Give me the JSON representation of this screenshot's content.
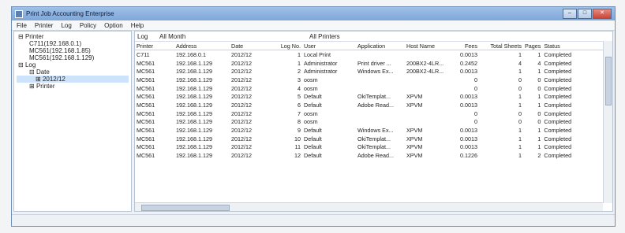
{
  "window": {
    "title": "Print Job Accounting Enterprise"
  },
  "menu": [
    "File",
    "Printer",
    "Log",
    "Policy",
    "Option",
    "Help"
  ],
  "tree": {
    "printer_root": "Printer",
    "printers": [
      "C711(192.168.0.1)",
      "MC561(192.168.1.85)",
      "MC561(192.168.1.129)"
    ],
    "log_root": "Log",
    "date": "Date",
    "date_child": "2012/12",
    "printer_child": "Printer"
  },
  "filter": {
    "label": "Log",
    "month": "All Month",
    "printers": "All Printers"
  },
  "table": {
    "columns": [
      "Printer",
      "Address",
      "Date",
      "Log No.",
      "User",
      "Application",
      "Host Name",
      "Fees",
      "Total Sheets",
      "Pages",
      "Status"
    ],
    "rows": [
      [
        "C711",
        "192.168.0.1",
        "2012/12",
        "1",
        "Local Print",
        "",
        "",
        "0.0013",
        "1",
        "1",
        "Completed"
      ],
      [
        "MC561",
        "192.168.1.129",
        "2012/12",
        "1",
        "Administrator",
        "Print driver ...",
        "200BX2-4LR...",
        "0.2452",
        "4",
        "4",
        "Completed"
      ],
      [
        "MC561",
        "192.168.1.129",
        "2012/12",
        "2",
        "Administrator",
        "Windows Ex...",
        "200BX2-4LR...",
        "0.0013",
        "1",
        "1",
        "Completed"
      ],
      [
        "MC561",
        "192.168.1.129",
        "2012/12",
        "3",
        "oosm",
        "",
        "",
        "0",
        "0",
        "0",
        "Completed"
      ],
      [
        "MC561",
        "192.168.1.129",
        "2012/12",
        "4",
        "oosm",
        "",
        "",
        "0",
        "0",
        "0",
        "Completed"
      ],
      [
        "MC561",
        "192.168.1.129",
        "2012/12",
        "5",
        "Default",
        "OkiTemplat...",
        "XPVM",
        "0.0013",
        "1",
        "1",
        "Completed"
      ],
      [
        "MC561",
        "192.168.1.129",
        "2012/12",
        "6",
        "Default",
        "Adobe Read...",
        "XPVM",
        "0.0013",
        "1",
        "1",
        "Completed"
      ],
      [
        "MC561",
        "192.168.1.129",
        "2012/12",
        "7",
        "oosm",
        "",
        "",
        "0",
        "0",
        "0",
        "Completed"
      ],
      [
        "MC561",
        "192.168.1.129",
        "2012/12",
        "8",
        "oosm",
        "",
        "",
        "0",
        "0",
        "0",
        "Completed"
      ],
      [
        "MC561",
        "192.168.1.129",
        "2012/12",
        "9",
        "Default",
        "Windows Ex...",
        "XPVM",
        "0.0013",
        "1",
        "1",
        "Completed"
      ],
      [
        "MC561",
        "192.168.1.129",
        "2012/12",
        "10",
        "Default",
        "OkiTemplat...",
        "XPVM",
        "0.0013",
        "1",
        "1",
        "Completed"
      ],
      [
        "MC561",
        "192.168.1.129",
        "2012/12",
        "11",
        "Default",
        "OkiTemplat...",
        "XPVM",
        "0.0013",
        "1",
        "1",
        "Completed"
      ],
      [
        "MC561",
        "192.168.1.129",
        "2012/12",
        "12",
        "Default",
        "Adobe Read...",
        "XPVM",
        "0.1226",
        "1",
        "2",
        "Completed"
      ]
    ]
  }
}
